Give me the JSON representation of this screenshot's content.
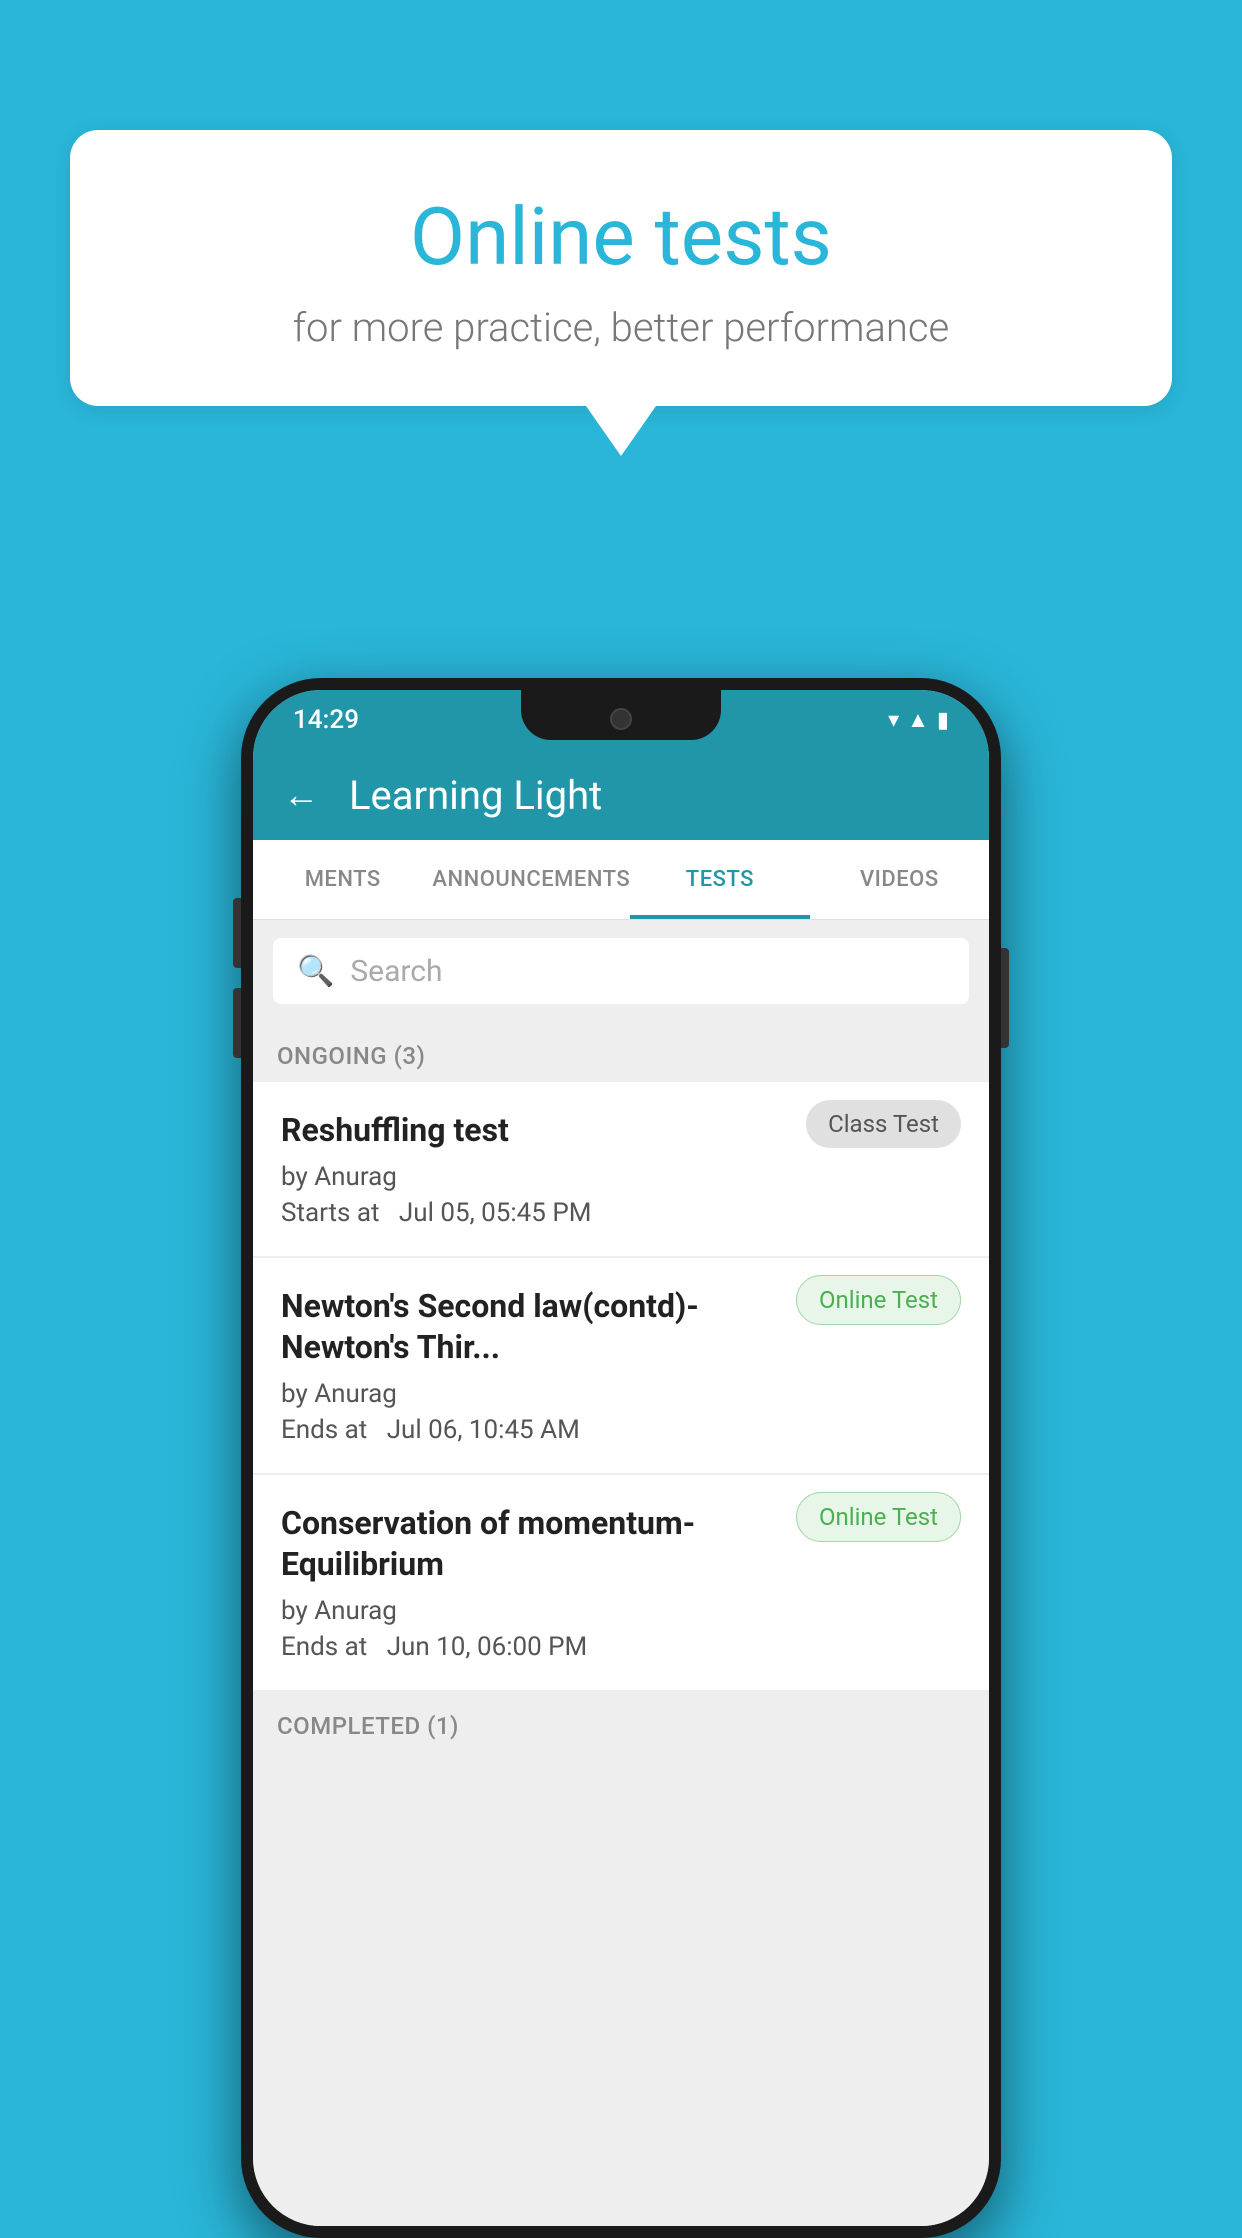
{
  "background_color": "#29b6d8",
  "speech_bubble": {
    "title": "Online tests",
    "subtitle": "for more practice, better performance"
  },
  "phone": {
    "status_bar": {
      "time": "14:29",
      "wifi_icon": "▾",
      "signal_icon": "▲",
      "battery_icon": "▮"
    },
    "app_bar": {
      "back_icon": "←",
      "title": "Learning Light"
    },
    "tabs": [
      {
        "label": "MENTS",
        "active": false
      },
      {
        "label": "ANNOUNCEMENTS",
        "active": false
      },
      {
        "label": "TESTS",
        "active": true
      },
      {
        "label": "VIDEOS",
        "active": false
      }
    ],
    "search": {
      "placeholder": "Search",
      "search_icon": "🔍"
    },
    "ongoing_section": {
      "header": "ONGOING (3)",
      "items": [
        {
          "title": "Reshuffling test",
          "author": "by Anurag",
          "time_label": "Starts at",
          "time": "Jul 05, 05:45 PM",
          "badge": "Class Test",
          "badge_type": "class"
        },
        {
          "title": "Newton's Second law(contd)-Newton's Thir...",
          "author": "by Anurag",
          "time_label": "Ends at",
          "time": "Jul 06, 10:45 AM",
          "badge": "Online Test",
          "badge_type": "online"
        },
        {
          "title": "Conservation of momentum-Equilibrium",
          "author": "by Anurag",
          "time_label": "Ends at",
          "time": "Jun 10, 06:00 PM",
          "badge": "Online Test",
          "badge_type": "online"
        }
      ]
    },
    "completed_section": {
      "header": "COMPLETED (1)"
    }
  }
}
